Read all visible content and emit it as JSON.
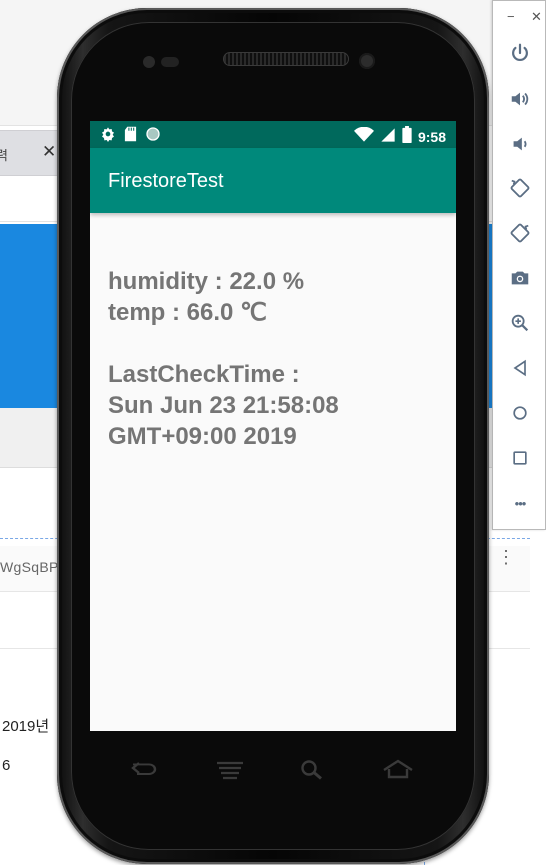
{
  "background": {
    "tab_label": "력",
    "tab_close": "✕",
    "document_id_fragment": "WgSqBP",
    "field_value_1": "2019년",
    "field_value_2": "6",
    "kebab_glyph": "⋮"
  },
  "emulator_toolbar": {
    "minimize_label": "−",
    "close_label": "✕",
    "buttons": [
      {
        "icon": "power-icon"
      },
      {
        "icon": "volume-up-icon"
      },
      {
        "icon": "volume-down-icon"
      },
      {
        "icon": "rotate-left-icon"
      },
      {
        "icon": "rotate-right-icon"
      },
      {
        "icon": "camera-icon"
      },
      {
        "icon": "zoom-icon"
      },
      {
        "icon": "back-icon"
      },
      {
        "icon": "home-icon"
      },
      {
        "icon": "overview-icon"
      },
      {
        "icon": "more-icon"
      }
    ],
    "more_label": "•••"
  },
  "status_bar": {
    "time": "9:58",
    "icons_left": [
      "settings-icon",
      "sd-card-icon",
      "sync-circle-icon"
    ],
    "icons_right": [
      "wifi-icon",
      "signal-icon",
      "battery-icon"
    ]
  },
  "app": {
    "title": "FirestoreTest",
    "humidity_line": "humidity : 22.0 %",
    "temp_line": "temp : 66.0 ℃",
    "last_check_label": "LastCheckTime :",
    "last_check_line1": "Sun Jun 23 21:58:08",
    "last_check_line2": "GMT+09:00 2019"
  },
  "phone_nav": [
    "back-key-icon",
    "menu-key-icon",
    "search-key-icon",
    "home-key-icon"
  ],
  "colors": {
    "status_bar": "#00695c",
    "app_bar": "#00897b",
    "content_text": "#757575",
    "background_banner": "#1a88e0"
  }
}
